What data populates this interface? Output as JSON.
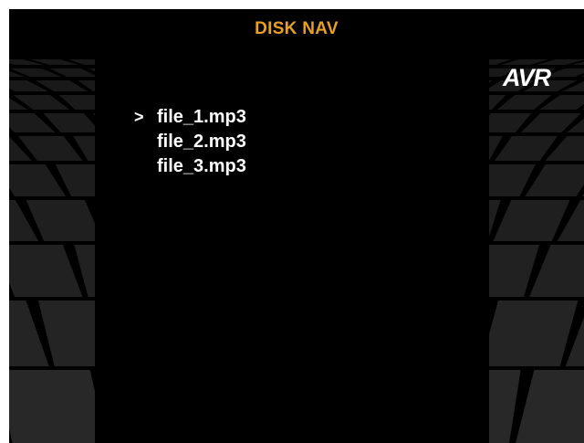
{
  "header": {
    "title": "DISK NAV"
  },
  "logo": {
    "text": "AVR"
  },
  "file_list": {
    "cursor": ">",
    "selected_index": 0,
    "items": [
      {
        "label": "file_1.mp3"
      },
      {
        "label": "file_2.mp3"
      },
      {
        "label": "file_3.mp3"
      }
    ]
  },
  "colors": {
    "title": "#e8a020",
    "text": "#ffffff",
    "background": "#000000",
    "tile": "#2b2b2b"
  }
}
